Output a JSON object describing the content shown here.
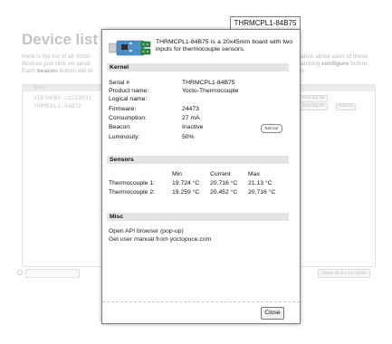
{
  "background": {
    "title": "Device list",
    "intro_line1": "Here is the list of all Yocto",
    "intro_line2": "devices just click on serial",
    "intro_line3a": "Each ",
    "intro_line3b": "beacon",
    "intro_line3c": " button will to",
    "intro_r1": "ation about each of these",
    "intro_r2a": "atching ",
    "intro_r2b": "configure",
    "intro_r2c": " button.",
    "intro_r3": "n.",
    "table_header": "Serial",
    "rows": [
      "VIRTHUB0-c2223931",
      "THRMCPL1-84B75"
    ],
    "row_button_log": "view log file",
    "row_button_beacon": "beacon",
    "show_button": "Show device functions"
  },
  "tab": {
    "label": "THRMCPL1-84B75"
  },
  "summary": {
    "text": "THRMCPL1-84B75 is a 20x45mm board with two inputs for thermocouple sensors."
  },
  "kernel": {
    "heading": "Kernel",
    "rows": [
      {
        "label": "Serial #",
        "value": "THRMCPL1-84B75"
      },
      {
        "label": "Product name:",
        "value": "Yocto-Thermocouple"
      },
      {
        "label": "Logical name:",
        "value": ""
      },
      {
        "label": "Firmware:",
        "value": "24473"
      },
      {
        "label": "Consumption:",
        "value": "27 mA"
      },
      {
        "label": "Beacon:",
        "value": "Inactive"
      },
      {
        "label": "Luminosity:",
        "value": "50%"
      }
    ],
    "beacon_button": "turn on"
  },
  "sensors": {
    "heading": "Sensors",
    "columns": [
      "Min",
      "Current",
      "Max"
    ],
    "rows": [
      {
        "name": "Thermocouple 1:",
        "min": "19.724 °C",
        "current": "20.716 °C",
        "max": "21.13 °C"
      },
      {
        "name": "Thermocouple 2:",
        "min": "19.259 °C",
        "current": "20.452 °C",
        "max": "20.716 °C"
      }
    ]
  },
  "misc": {
    "heading": "Misc",
    "links": [
      "Open API browser (pop-up)",
      "Get user manual from yoctopuce.com"
    ]
  },
  "dialog": {
    "close_label": "Close"
  },
  "colors": {
    "section_bg": "#e4e4e4",
    "board_blue": "#4a8fc7",
    "dialog_border": "#7d7d7d"
  },
  "icons": {
    "device_image": "yocto-thermocouple-board-icon",
    "search": "search-icon"
  }
}
